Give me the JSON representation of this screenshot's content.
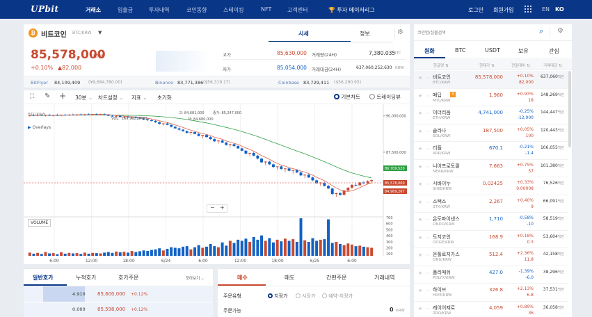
{
  "brand": {
    "logo": "UPbit"
  },
  "nav": {
    "items": [
      "거래소",
      "입출금",
      "투자내역",
      "코인동향",
      "스테이킹",
      "NFT",
      "고객센터"
    ],
    "promo": "투자 메이저리그",
    "login": "로그인",
    "signup": "회원가입",
    "lang_en": "EN",
    "lang_ko": "KO"
  },
  "coin": {
    "name": "비트코인",
    "pair": "BTC/KRW",
    "price": "85,578,000",
    "unit": "KRW",
    "change_pct": "+0.10%",
    "change_amt": "▲82,000",
    "tab_quote": "시세",
    "tab_info": "정보",
    "high_label": "고가",
    "high": "85,630,000",
    "low_label": "저가",
    "low": "85,054,000",
    "vol_label": "거래량(24H)",
    "vol": "7,380.035",
    "vol_unit": "BTC",
    "amt_label": "거래대금(24H)",
    "amt": "637,060,252,630",
    "amt_unit": "KRW"
  },
  "premiums": [
    {
      "exchange": "BitFlyer",
      "price": "84,109,409",
      "sub": "(¥9,684,780.00)"
    },
    {
      "exchange": "Binance",
      "price": "83,771,386",
      "sub": "($56,319.17)"
    },
    {
      "exchange": "Coinbase",
      "price": "83,729,411",
      "sub": "($56,290.95)"
    }
  ],
  "toolbar": {
    "interval": "30분",
    "settings": "차트설정",
    "indicators": "지표",
    "reset": "초기화",
    "basic_chart": "기본차트",
    "tradingview": "트레이딩뷰"
  },
  "chart_overlay": {
    "symbol": "BTC/KRW",
    "overlays": "Overlays",
    "volume": "VOLUME",
    "vol_text": "VOL:",
    "vol_num": "169.99210483",
    "h_label": "고:",
    "h_val": "84,681,000",
    "c_label": "종가:",
    "c_val": "85,247,000",
    "l_label": "저:",
    "l_val": "84,680,000",
    "zoom_out": "−",
    "zoom_in": "+"
  },
  "chart_data": {
    "type": "candlestick",
    "x_ticks": [
      "6:00",
      "12:00",
      "18:00",
      "6/24",
      "6:00",
      "12:00",
      "18:00",
      "6/25",
      "6:00"
    ],
    "y_ticks": [
      "90,000,000",
      "87,500,000"
    ],
    "volume_ticks": [
      "700",
      "600",
      "500",
      "400",
      "300",
      "200",
      "100"
    ],
    "price_labels": [
      {
        "value": "86,709,520",
        "color": "#2ea043"
      },
      {
        "value": "85,578,000",
        "color": "#c84a31"
      },
      {
        "value": "84,969,267",
        "color": "#c84a31"
      }
    ],
    "candles": [
      [
        90000000,
        90080000,
        89950000,
        90050000
      ],
      [
        90050000,
        90120000,
        89980000,
        90010000
      ],
      [
        90010000,
        90100000,
        89960000,
        90060000
      ],
      [
        90060000,
        90110000,
        89990000,
        90020000
      ],
      [
        90020000,
        90090000,
        89950000,
        90070000
      ],
      [
        90070000,
        90140000,
        90000000,
        90030000
      ],
      [
        90030000,
        90080000,
        89960000,
        90060000
      ],
      [
        90060000,
        90130000,
        90010000,
        90040000
      ],
      [
        90040000,
        90100000,
        89970000,
        90080000
      ],
      [
        90080000,
        90150000,
        90020000,
        90050000
      ],
      [
        90050000,
        90120000,
        89990000,
        90090000
      ],
      [
        90090000,
        90160000,
        90030000,
        90060000
      ],
      [
        90060000,
        90110000,
        90000000,
        90100000
      ],
      [
        90100000,
        90170000,
        90040000,
        90070000
      ],
      [
        90070000,
        90130000,
        90010000,
        90110000
      ],
      [
        90110000,
        90180000,
        90050000,
        90080000
      ],
      [
        90080000,
        90140000,
        90020000,
        90120000
      ],
      [
        90120000,
        90190000,
        90060000,
        90090000
      ],
      [
        90090000,
        90150000,
        90030000,
        90110000
      ],
      [
        90110000,
        90180000,
        90040000,
        90070000
      ],
      [
        90070000,
        90120000,
        89980000,
        90010000
      ],
      [
        90010000,
        90080000,
        89920000,
        89960000
      ],
      [
        89960000,
        90040000,
        89880000,
        90000000
      ],
      [
        90000000,
        90060000,
        89890000,
        89920000
      ],
      [
        89920000,
        89990000,
        89820000,
        89950000
      ],
      [
        89950000,
        90020000,
        89870000,
        89900000
      ],
      [
        89900000,
        89960000,
        89800000,
        89930000
      ],
      [
        89930000,
        89980000,
        89830000,
        89870000
      ],
      [
        89870000,
        89920000,
        89760000,
        89820000
      ],
      [
        89820000,
        89880000,
        89700000,
        89760000
      ],
      [
        89760000,
        89820000,
        89650000,
        89700000
      ],
      [
        89700000,
        89780000,
        89600000,
        89660000
      ],
      [
        89660000,
        89720000,
        89520000,
        89560000
      ],
      [
        89560000,
        89620000,
        89400000,
        89450000
      ],
      [
        89450000,
        89520000,
        89330000,
        89480000
      ],
      [
        89480000,
        89550000,
        89360000,
        89380000
      ],
      [
        89380000,
        89420000,
        89200000,
        89250000
      ],
      [
        89250000,
        89320000,
        89100000,
        89140000
      ],
      [
        89140000,
        89200000,
        88980000,
        89050000
      ],
      [
        89050000,
        89120000,
        88900000,
        88950000
      ],
      [
        88950000,
        89000000,
        88780000,
        88830000
      ],
      [
        88830000,
        88920000,
        88700000,
        88880000
      ],
      [
        88880000,
        88950000,
        88720000,
        88760000
      ],
      [
        88760000,
        88820000,
        88580000,
        88620000
      ],
      [
        88620000,
        88700000,
        88450000,
        88680000
      ],
      [
        88680000,
        88740000,
        88500000,
        88540000
      ],
      [
        88540000,
        88600000,
        88350000,
        88400000
      ],
      [
        88400000,
        88460000,
        88200000,
        88250000
      ],
      [
        88250000,
        88320000,
        88080000,
        88300000
      ],
      [
        88300000,
        88360000,
        88120000,
        88160000
      ],
      [
        88160000,
        88220000,
        87950000,
        88000000
      ],
      [
        88000000,
        88080000,
        87820000,
        88050000
      ],
      [
        88050000,
        88100000,
        87880000,
        87920000
      ],
      [
        87920000,
        87980000,
        87720000,
        87760000
      ],
      [
        87760000,
        87830000,
        87560000,
        87600000
      ],
      [
        87600000,
        87650000,
        87350000,
        87400000
      ],
      [
        87400000,
        87480000,
        87200000,
        87450000
      ],
      [
        87450000,
        87520000,
        87220000,
        87260000
      ],
      [
        87260000,
        87320000,
        87000000,
        87060000
      ],
      [
        87060000,
        87100000,
        86750000,
        86800000
      ],
      [
        86800000,
        86880000,
        86600000,
        86850000
      ],
      [
        86850000,
        86920000,
        86620000,
        86660000
      ],
      [
        86660000,
        86720000,
        86420000,
        86480000
      ],
      [
        86480000,
        86540000,
        86280000,
        86520000
      ],
      [
        86520000,
        86580000,
        86300000,
        86340000
      ],
      [
        86340000,
        86400000,
        86120000,
        86380000
      ],
      [
        86380000,
        86450000,
        86180000,
        86220000
      ],
      [
        86220000,
        86280000,
        86000000,
        86260000
      ],
      [
        86260000,
        86320000,
        86050000,
        86100000
      ],
      [
        86100000,
        86160000,
        85850000,
        85900000
      ],
      [
        85900000,
        85980000,
        85700000,
        85950000
      ],
      [
        85950000,
        86000000,
        85720000,
        85760000
      ],
      [
        85760000,
        85820000,
        85500000,
        85560000
      ],
      [
        85560000,
        85620000,
        85300000,
        85360000
      ],
      [
        85360000,
        85440000,
        85180000,
        85400000
      ],
      [
        85400000,
        85460000,
        85140000,
        85180000
      ],
      [
        85180000,
        85260000,
        84950000,
        85000000
      ],
      [
        85000000,
        85050000,
        84550000,
        84620000
      ],
      [
        84620000,
        84700000,
        84420000,
        84680000
      ],
      [
        84680000,
        84740000,
        84500000,
        84560000
      ],
      [
        84560000,
        84900000,
        84520000,
        84860000
      ],
      [
        84860000,
        85100000,
        84800000,
        85050000
      ],
      [
        85050000,
        85300000,
        84980000,
        85250000
      ],
      [
        85250000,
        85400000,
        85150000,
        85220000
      ],
      [
        85220000,
        85450000,
        85180000,
        85420000
      ],
      [
        85420000,
        85500000,
        85300000,
        85350000
      ],
      [
        85350000,
        85560000,
        85320000,
        85500000
      ],
      [
        85500000,
        85630000,
        85400000,
        85578000
      ]
    ],
    "volumes": [
      60,
      40,
      55,
      35,
      70,
      45,
      50,
      30,
      65,
      40,
      55,
      45,
      50,
      35,
      60,
      40,
      55,
      50,
      45,
      60,
      70,
      55,
      80,
      65,
      75,
      60,
      90,
      70,
      85,
      100,
      90,
      110,
      120,
      140,
      100,
      130,
      160,
      150,
      140,
      170,
      180,
      120,
      160,
      200,
      150,
      170,
      220,
      180,
      160,
      250,
      190,
      280,
      240,
      300,
      280,
      320,
      260,
      350,
      300,
      380,
      280,
      330,
      250,
      300,
      270,
      320,
      280,
      310,
      260,
      700,
      290,
      260,
      330,
      280,
      300,
      310,
      680,
      240,
      260,
      220,
      200,
      230,
      210,
      180,
      190,
      170,
      160,
      150
    ],
    "ylim": [
      84000000,
      90800000
    ]
  },
  "orderbook": {
    "tabs": [
      "일반호가",
      "누적호가",
      "호가주문"
    ],
    "view": "모아보기",
    "rows": [
      {
        "qty": "4.910",
        "price": "85,600,000",
        "pct": "+0.12%"
      },
      {
        "qty": "0.000",
        "price": "85,598,000",
        "pct": "+0.12%"
      }
    ]
  },
  "order": {
    "tabs": [
      "매수",
      "매도",
      "간편주문",
      "거래내역"
    ],
    "type_label": "주문유형",
    "limit": "지정가",
    "market": "시장가",
    "reserve": "예약-지정가",
    "avail_label": "주문가능",
    "avail_value": "0",
    "avail_unit": "KRW"
  },
  "market": {
    "search_placeholder": "코인명/심볼검색",
    "tabs": [
      "원화",
      "BTC",
      "USDT",
      "보유",
      "관심"
    ],
    "headers": [
      "한글명",
      "현재가",
      "전일대비",
      "거래대금"
    ],
    "coins": [
      {
        "name": "비트코인",
        "sym": "BTC/KRW",
        "price": "85,578,000",
        "chg": "+0.10%",
        "amt": "82,000",
        "vol": "637,060",
        "dir": "up",
        "sel": true
      },
      {
        "name": "메딥",
        "sym": "MTL/KRW",
        "price": "1,960",
        "chg": "+0.93%",
        "amt": "18",
        "vol": "148,269",
        "dir": "up",
        "badge": "주"
      },
      {
        "name": "이더리움",
        "sym": "ETH/KRW",
        "price": "4,741,000",
        "chg": "-0.25%",
        "amt": "-12,000",
        "vol": "144,447",
        "dir": "down"
      },
      {
        "name": "솔라나",
        "sym": "SOL/KRW",
        "price": "187,500",
        "chg": "+0.05%",
        "amt": "100",
        "vol": "120,443",
        "dir": "up"
      },
      {
        "name": "리플",
        "sym": "XRP/KRW",
        "price": "670.1",
        "chg": "-0.21%",
        "amt": "-1.4",
        "vol": "106,055",
        "dir": "down"
      },
      {
        "name": "니어프로토콜",
        "sym": "NEAR/KRW",
        "price": "7,663",
        "chg": "+0.75%",
        "amt": "57",
        "vol": "101,380",
        "dir": "up"
      },
      {
        "name": "시바이누",
        "sym": "SHIB/KRW",
        "price": "0.02425",
        "chg": "+0.33%",
        "amt": "0.00008",
        "vol": "76,526",
        "dir": "up"
      },
      {
        "name": "스택스",
        "sym": "STX/KRW",
        "price": "2,267",
        "chg": "+0.40%",
        "amt": "9",
        "vol": "66,091",
        "dir": "up"
      },
      {
        "name": "온도파이낸스",
        "sym": "ONDO/KRW",
        "price": "1,710",
        "chg": "-0.58%",
        "amt": "-10",
        "vol": "58,519",
        "dir": "down"
      },
      {
        "name": "도지코인",
        "sym": "DOGE/KRW",
        "price": "168.9",
        "chg": "+0.18%",
        "amt": "0.3",
        "vol": "53,604",
        "dir": "up"
      },
      {
        "name": "온톨로지가스",
        "sym": "ONG/KRW",
        "price": "512.4",
        "chg": "+2.36%",
        "amt": "11.8",
        "vol": "42,158",
        "dir": "up"
      },
      {
        "name": "폴리매쉬",
        "sym": "POLYX/KRW",
        "price": "427.0",
        "chg": "-1.39%",
        "amt": "-6.0",
        "vol": "38,296",
        "dir": "down"
      },
      {
        "name": "하이브",
        "sym": "HIVE/KRW",
        "price": "326.8",
        "chg": "+2.13%",
        "amt": "6.8",
        "vol": "37,531",
        "dir": "up"
      },
      {
        "name": "레이어제로",
        "sym": "ZRO/KRW",
        "price": "4,059",
        "chg": "+0.89%",
        "amt": "36",
        "vol": "36,058",
        "dir": "up"
      }
    ],
    "vol_unit": "백만"
  },
  "colors": {
    "brand": "#093687",
    "up": "#c84a31",
    "down": "#1261c4",
    "ma_long": "#2ea043",
    "ma_short": "#e0604a"
  }
}
